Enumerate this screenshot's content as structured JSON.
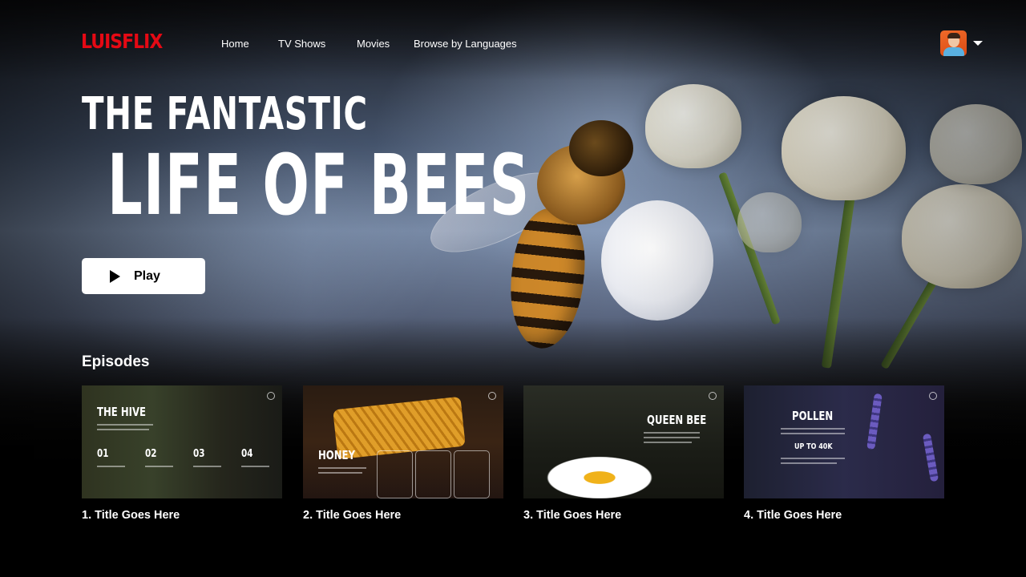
{
  "brand": {
    "logo": "LUISFLIX",
    "accent": "#e50914"
  },
  "nav": {
    "links": [
      "Home",
      "TV Shows",
      "Movies",
      "Browse by Languages"
    ]
  },
  "hero": {
    "title_line1": "THE FANTASTIC",
    "title_line2": "LIFE OF BEES",
    "play_label": "Play"
  },
  "episodes": {
    "heading": "Episodes",
    "items": [
      {
        "title": "1. Title Goes Here",
        "thumb_label": "THE HIVE",
        "thumb_numbers": [
          "01",
          "02",
          "03",
          "04"
        ]
      },
      {
        "title": "2. Title Goes Here",
        "thumb_label": "HONEY"
      },
      {
        "title": "3. Title Goes Here",
        "thumb_label": "QUEEN BEE"
      },
      {
        "title": "4.  Title Goes Here",
        "thumb_label": "POLLEN",
        "thumb_sublabel": "UP TO 40K"
      }
    ]
  },
  "icons": {
    "play": "play-icon",
    "profile_menu": "chevron-down-icon",
    "thumb_info": "info-icon"
  }
}
